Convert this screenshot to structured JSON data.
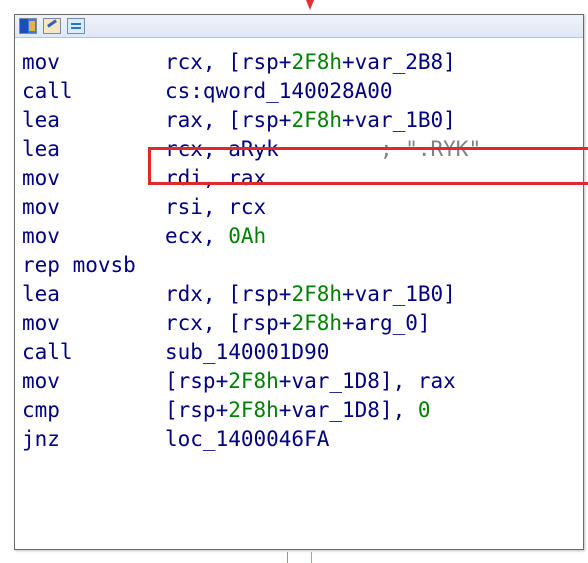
{
  "toolbar": {
    "icons": [
      "graph-view-icon",
      "edit-icon",
      "text-view-icon"
    ]
  },
  "lines": [
    {
      "mnemonic": "mov",
      "parts": [
        {
          "t": "rcx, [rsp+",
          "c": "op"
        },
        {
          "t": "2F8h",
          "c": "num"
        },
        {
          "t": "+var_2B8]",
          "c": "op"
        }
      ]
    },
    {
      "mnemonic": "call",
      "parts": [
        {
          "t": "cs:qword_140028A00",
          "c": "op"
        }
      ]
    },
    {
      "mnemonic": "lea",
      "parts": [
        {
          "t": "rax, [rsp+",
          "c": "op"
        },
        {
          "t": "2F8h",
          "c": "num"
        },
        {
          "t": "+var_1B0]",
          "c": "op"
        }
      ]
    },
    {
      "mnemonic": "lea",
      "parts": [
        {
          "t": "rcx, aRyk",
          "c": "op"
        },
        {
          "t": "        ; \".RYK\"",
          "c": "cmt"
        }
      ]
    },
    {
      "mnemonic": "mov",
      "parts": [
        {
          "t": "rdi, rax",
          "c": "op"
        }
      ]
    },
    {
      "mnemonic": "mov",
      "parts": [
        {
          "t": "rsi, rcx",
          "c": "op"
        }
      ]
    },
    {
      "mnemonic": "mov",
      "parts": [
        {
          "t": "ecx, ",
          "c": "op"
        },
        {
          "t": "0Ah",
          "c": "num"
        }
      ]
    },
    {
      "mnemonic": "rep movsb",
      "parts": []
    },
    {
      "mnemonic": "lea",
      "parts": [
        {
          "t": "rdx, [rsp+",
          "c": "op"
        },
        {
          "t": "2F8h",
          "c": "num"
        },
        {
          "t": "+var_1B0]",
          "c": "op"
        }
      ]
    },
    {
      "mnemonic": "mov",
      "parts": [
        {
          "t": "rcx, [rsp+",
          "c": "op"
        },
        {
          "t": "2F8h",
          "c": "num"
        },
        {
          "t": "+arg_0]",
          "c": "op"
        }
      ]
    },
    {
      "mnemonic": "call",
      "parts": [
        {
          "t": "sub_140001D90",
          "c": "op"
        }
      ]
    },
    {
      "mnemonic": "mov",
      "parts": [
        {
          "t": "[rsp+",
          "c": "op"
        },
        {
          "t": "2F8h",
          "c": "num"
        },
        {
          "t": "+var_1D8], rax",
          "c": "op"
        }
      ]
    },
    {
      "mnemonic": "cmp",
      "parts": [
        {
          "t": "[rsp+",
          "c": "op"
        },
        {
          "t": "2F8h",
          "c": "num"
        },
        {
          "t": "+var_1D8], ",
          "c": "op"
        },
        {
          "t": "0",
          "c": "num"
        }
      ]
    },
    {
      "mnemonic": "jnz",
      "parts": [
        {
          "t": "loc_1400046FA",
          "c": "op"
        }
      ]
    }
  ],
  "highlight": {
    "line_index": 3,
    "color": "#e02a2a"
  },
  "colors": {
    "text": "#000080",
    "number": "#008000",
    "comment": "#808080"
  }
}
